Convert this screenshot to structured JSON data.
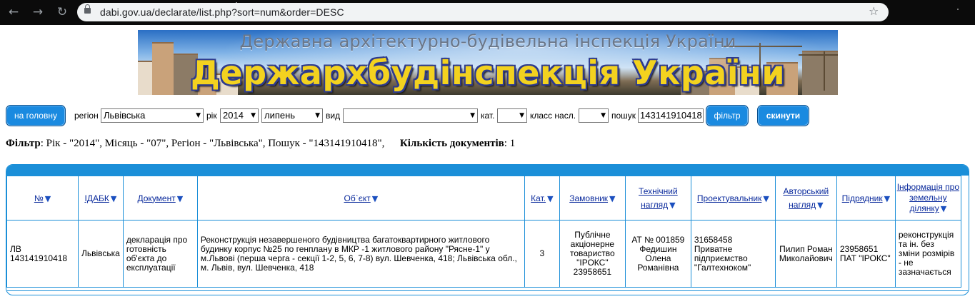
{
  "browser": {
    "url": "dabi.gov.ua/declarate/list.php?sort=num&order=DESC",
    "back_icon": "arrow-left-icon",
    "forward_icon": "arrow-right-icon",
    "reload_icon": "reload-icon",
    "lock_icon": "lock-icon",
    "bookmark_icon": "star-icon"
  },
  "banner": {
    "subtitle": "Державна архітектурно-будівельна інспекція України",
    "title": "Держархбудінспекція України"
  },
  "toolbar": {
    "home_label": "на головну",
    "region_label": "регіон",
    "region_value": "Львівська",
    "year_label": "рік",
    "year_value": "2014",
    "month_value": "липень",
    "type_label": "вид",
    "type_value": "",
    "category_label": "кат.",
    "category_value": "",
    "class_label": "класс насл.",
    "class_value": "",
    "search_label": "пошук",
    "search_value": "143141910418",
    "filter_label": "фільтр",
    "reset_label": "скинути"
  },
  "summary": {
    "filter_key": "Фільтр",
    "filter_text": ": Рік - \"2014\", Місяць - \"07\", Регіон - \"Львівська\", Пошук - \"143141910418\",",
    "count_key": "Кількість документів",
    "count_value": ": 1"
  },
  "table": {
    "headers": [
      "№",
      "ІДАБК",
      "Документ",
      "Об`єкт",
      "Кат.",
      "Замовник",
      "Технічний нагляд",
      "Проектувальник",
      "Авторський нагляд",
      "Підрядник",
      "Інформація про земельну ділянку"
    ],
    "rows": [
      {
        "num": "ЛВ 143141910418",
        "idabk": "Львівська",
        "document": "декларація про готовність об'єкта до експлуатації",
        "object": "Реконструкція незавершеного будівництва багатоквартирного житлового будинку корпус №25 по генплану в МКР -1 житлового району \"Рясне-1\" у м.Львові (перша черга - секції 1-2, 5, 6, 7-8) вул. Шевченка, 418; Львівська обл., м. Львів, вул. Шевченка, 418",
        "category": "3",
        "customer": "Публічне акціонерне товариство \"ІРОКС\" 23958651",
        "tech_supervision": "АТ № 001859 Федишин Олена Романівна",
        "designer": "31658458 Приватне підприємство \"Галтехноком\"",
        "author_supervision": "Пилип Роман Миколайович",
        "contractor": "23958651 ПАТ \"ІРОКС\"",
        "land_info": "реконструкція та ін. без зміни розмірів - не зазначається"
      }
    ]
  },
  "colors": {
    "accent": "#1b8fd8",
    "button": "#1a8ae0",
    "header_link": "#0a2a9c",
    "banner_title": "#f3d21f"
  }
}
